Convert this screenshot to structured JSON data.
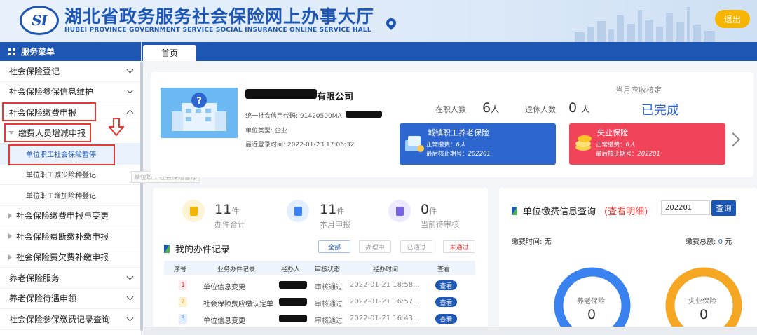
{
  "header": {
    "title_cn": "湖北省政务服务社会保险网上办事大厅",
    "title_en": "HUBEI PROVINCE GOVERNMENT SERVICE SOCIAL INSURANCE ONLINE SERVICE HALL",
    "logo_text": "SI",
    "logout_label": "退出"
  },
  "sidebar": {
    "header": "服务菜单",
    "items": [
      {
        "label": "社会保险登记"
      },
      {
        "label": "社会保险参保信息维护"
      },
      {
        "label": "社会保险缴费申报"
      },
      {
        "label": "缴费人员增减申报"
      },
      {
        "label": "单位职工社会保险暂停"
      },
      {
        "label": "单位职工减少险种登记"
      },
      {
        "label": "单位职工增加险种登记"
      },
      {
        "label": "社会保险缴费申报与变更"
      },
      {
        "label": "社会保险费断缴补缴申报"
      },
      {
        "label": "社会保险费欠费补缴申报"
      },
      {
        "label": "养老保险服务"
      },
      {
        "label": "养老保险待遇申领"
      },
      {
        "label": "社会保险参保缴费记录查询"
      }
    ],
    "tooltip": "单位职工社会保险暂停"
  },
  "tabs": [
    {
      "label": "首页"
    }
  ],
  "company": {
    "name_suffix": "有限公司",
    "credit_code": "统一社会信用代码: 91420500MA",
    "unit_type": "单位类型: 企业",
    "last_login": "最近登录时间:   2022-01-23 17:06:32",
    "employed_label": "在职人数",
    "employed_count": "6",
    "retired_label": "退休人数",
    "retired_count": "0",
    "person_unit": "人",
    "monthly_label": "当月应收核定",
    "monthly_status": "已完成"
  },
  "insurance_tiles": [
    {
      "title": "城镇职工养老保险",
      "normal_label": "正常缴费：",
      "normal_value": "6人",
      "period_label": "最后核止期号：",
      "period_value": "202201",
      "color": "#2e66d0"
    },
    {
      "title": "失业保险",
      "normal_label": "正常缴费：",
      "normal_value": "6人",
      "period_label": "最后核止期号：",
      "period_value": "202201",
      "color": "#f1435a"
    }
  ],
  "kpis": [
    {
      "value": "11",
      "unit": "件",
      "label": "办件合计",
      "bg": "#fff3d6",
      "fg": "#f5b400"
    },
    {
      "value": "11",
      "unit": "件",
      "label": "本月申报",
      "bg": "#e3efff",
      "fg": "#3a82f0"
    },
    {
      "value": "0",
      "unit": "件",
      "label": "当前待审核",
      "bg": "#eeeafd",
      "fg": "#7a63e0"
    }
  ],
  "records": {
    "title": "我的办件记录",
    "filters": [
      "全部",
      "办理中",
      "已通过",
      "未通过"
    ],
    "columns": [
      "序号",
      "业务办件记录",
      "经办人",
      "审核状态",
      "经办时间",
      "查看"
    ],
    "rows": [
      {
        "no": "1",
        "item": "单位信息变更",
        "status": "审核通过",
        "time": "2022-01-21 18:58...",
        "action": "查看"
      },
      {
        "no": "2",
        "item": "社会保险费应缴认定单",
        "status": "审核通过",
        "time": "2022-01-21 16:57...",
        "action": "查看"
      },
      {
        "no": "3",
        "item": "单位信息变更",
        "status": "审核通过",
        "time": "2022-01-21 16:43...",
        "action": "查看"
      }
    ]
  },
  "payment": {
    "title": "单位缴费信息查询",
    "detail_link": "(查看明细)",
    "period_value": "202201",
    "query_label": "查询",
    "pay_time_label": "缴费时间:",
    "pay_time_value": "无",
    "total_label": "缴费总额:",
    "total_value": "0",
    "total_unit": "元",
    "donuts": [
      {
        "label": "养老保险",
        "value": "0",
        "color": "#3a82f0"
      },
      {
        "label": "失业保险",
        "value": "0",
        "color": "#f5a623"
      }
    ]
  }
}
